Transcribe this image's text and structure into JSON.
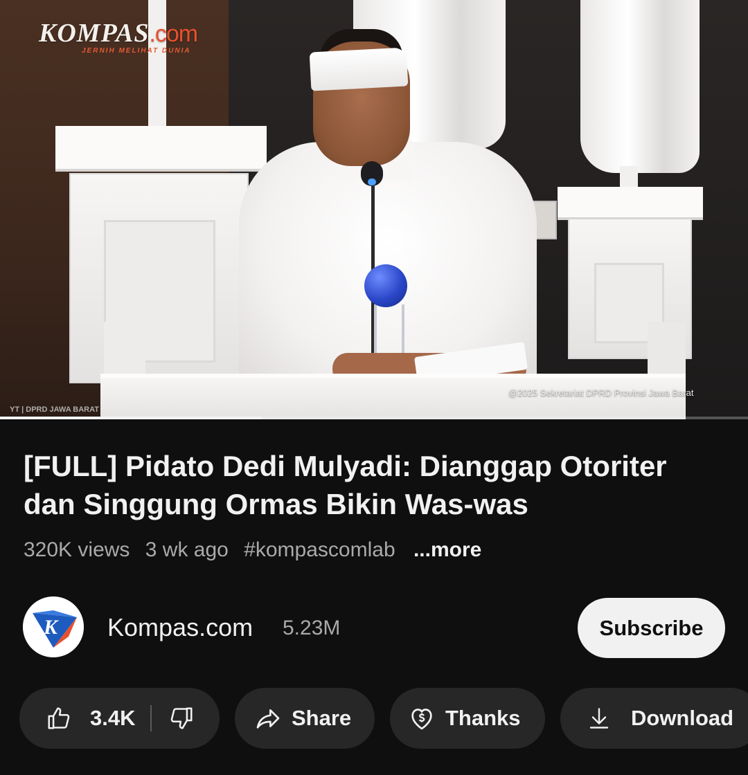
{
  "video": {
    "brand_logo": "KOMPAS",
    "brand_logo_suffix": ".com",
    "brand_tagline": "JERNIH MELIHAT DUNIA",
    "source_left": "YT | DPRD JAWA BARAT",
    "source_right": "@2025 Sekretariat DPRD Provinsi Jawa Barat",
    "progress_fraction": 0.35
  },
  "details": {
    "title": "[FULL] Pidato Dedi Mulyadi: Dianggap Otoriter dan Singgung Ormas Bikin Was-was",
    "views": "320K views",
    "age": "3 wk ago",
    "hashtag": "#kompascomlab",
    "more_label": "...more"
  },
  "channel": {
    "avatar_letter": "K",
    "name": "Kompas.com",
    "subscribers": "5.23M",
    "subscribe_label": "Subscribe"
  },
  "actions": {
    "like_count": "3.4K",
    "share_label": "Share",
    "thanks_label": "Thanks",
    "download_label": "Download"
  },
  "colors": {
    "background": "#0f0f0f",
    "pill": "#272727",
    "subscribe_bg": "#f1f1f1",
    "brand_orange": "#e8502d",
    "avatar_blue": "#1e5bbf"
  }
}
